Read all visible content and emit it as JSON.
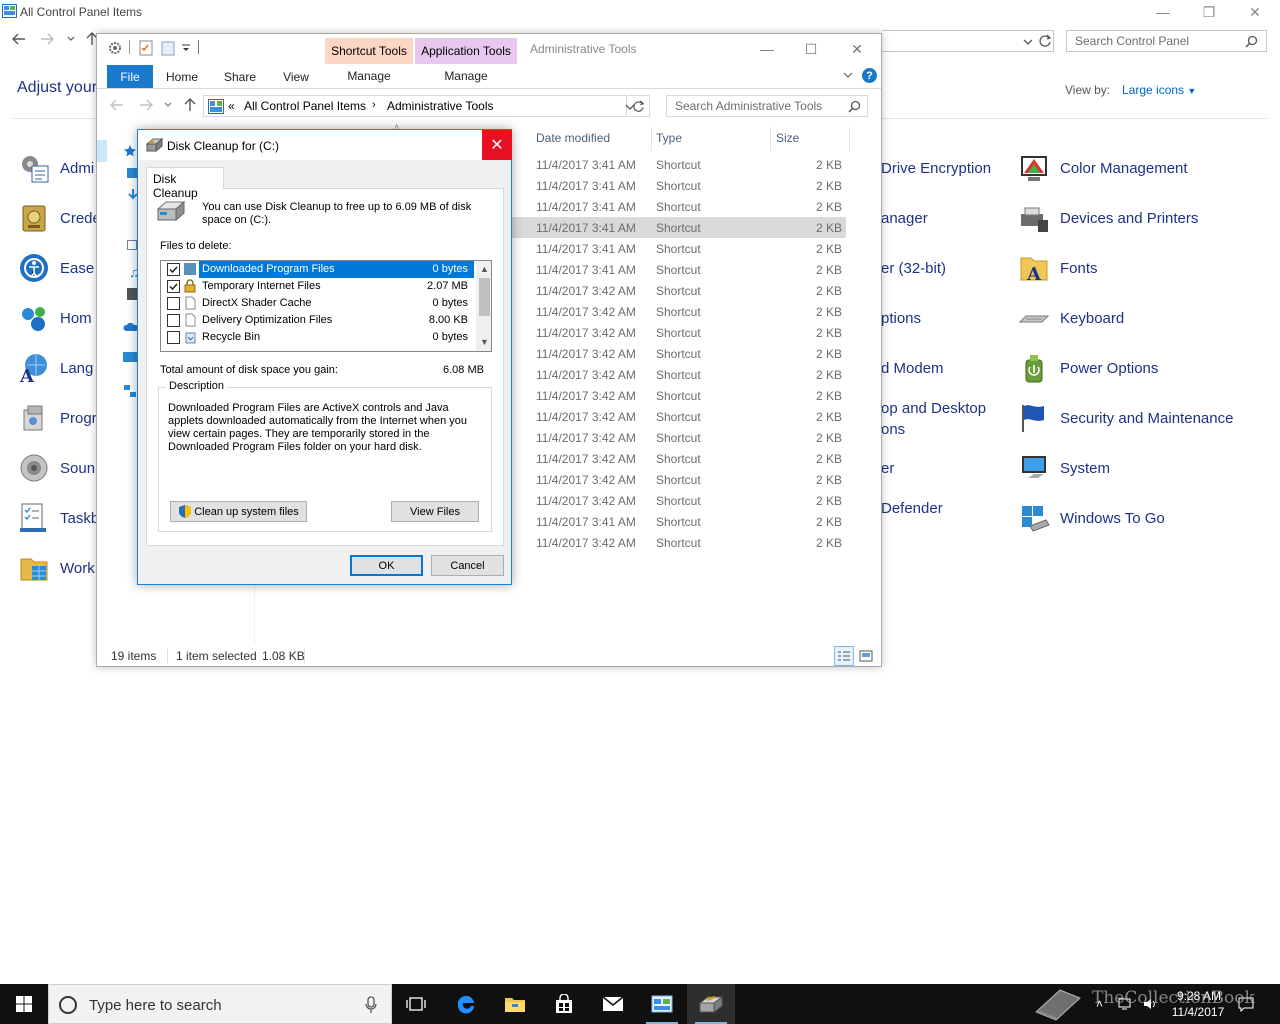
{
  "control_panel": {
    "window_title": "All Control Panel Items",
    "search_placeholder": "Search Control Panel",
    "heading": "Adjust your",
    "view_by_label": "View by:",
    "view_by_value": "Large icons",
    "left_items": [
      {
        "label": "Admi",
        "icon": "administrative-tools-icon"
      },
      {
        "label": "Crede",
        "icon": "credential-manager-icon"
      },
      {
        "label": "Ease",
        "icon": "ease-of-access-icon"
      },
      {
        "label": "Hom",
        "icon": "homegroup-icon"
      },
      {
        "label": "Lang",
        "icon": "language-icon"
      },
      {
        "label": "Progr",
        "icon": "programs-icon"
      },
      {
        "label": "Soun",
        "icon": "sound-icon"
      },
      {
        "label": "Taskb",
        "icon": "taskbar-icon"
      },
      {
        "label": "Work",
        "icon": "work-folders-icon"
      }
    ],
    "mid_items": [
      {
        "label": "Drive Encryption"
      },
      {
        "label": "anager"
      },
      {
        "label": "er (32-bit)"
      },
      {
        "label": "ptions"
      },
      {
        "label": "d Modem"
      },
      {
        "label": "op and Desktop"
      },
      {
        "label": "ons"
      },
      {
        "label": "er"
      },
      {
        "label": "Defender"
      }
    ],
    "right_items": [
      {
        "label": "Color Management",
        "icon": "color-management-icon"
      },
      {
        "label": "Devices and Printers",
        "icon": "devices-printers-icon"
      },
      {
        "label": "Fonts",
        "icon": "fonts-icon"
      },
      {
        "label": "Keyboard",
        "icon": "keyboard-icon"
      },
      {
        "label": "Power Options",
        "icon": "power-options-icon"
      },
      {
        "label": "Security and Maintenance",
        "icon": "security-flag-icon"
      },
      {
        "label": "System",
        "icon": "system-icon"
      },
      {
        "label": "Windows To Go",
        "icon": "windows-to-go-icon"
      }
    ]
  },
  "explorer": {
    "title": "Administrative Tools",
    "ctx_shortcut": "Shortcut Tools",
    "ctx_application": "Application Tools",
    "tabs": {
      "file": "File",
      "home": "Home",
      "share": "Share",
      "view": "View",
      "manage1": "Manage",
      "manage2": "Manage"
    },
    "breadcrumb": {
      "sep": "«",
      "parent": "All Control Panel Items",
      "current": "Administrative Tools"
    },
    "search_placeholder": "Search Administrative Tools",
    "columns": {
      "date": "Date modified",
      "type": "Type",
      "size": "Size"
    },
    "rows": [
      {
        "date": "11/4/2017 3:41 AM",
        "type": "Shortcut",
        "size": "2 KB"
      },
      {
        "date": "11/4/2017 3:41 AM",
        "type": "Shortcut",
        "size": "2 KB"
      },
      {
        "date": "11/4/2017 3:41 AM",
        "type": "Shortcut",
        "size": "2 KB"
      },
      {
        "date": "11/4/2017 3:41 AM",
        "type": "Shortcut",
        "size": "2 KB"
      },
      {
        "date": "11/4/2017 3:41 AM",
        "type": "Shortcut",
        "size": "2 KB"
      },
      {
        "date": "11/4/2017 3:41 AM",
        "type": "Shortcut",
        "size": "2 KB"
      },
      {
        "date": "11/4/2017 3:42 AM",
        "type": "Shortcut",
        "size": "2 KB"
      },
      {
        "date": "11/4/2017 3:42 AM",
        "type": "Shortcut",
        "size": "2 KB"
      },
      {
        "date": "11/4/2017 3:42 AM",
        "type": "Shortcut",
        "size": "2 KB"
      },
      {
        "date": "11/4/2017 3:42 AM",
        "type": "Shortcut",
        "size": "2 KB"
      },
      {
        "date": "11/4/2017 3:42 AM",
        "type": "Shortcut",
        "size": "2 KB"
      },
      {
        "date": "11/4/2017 3:42 AM",
        "type": "Shortcut",
        "size": "2 KB"
      },
      {
        "date": "11/4/2017 3:42 AM",
        "type": "Shortcut",
        "size": "2 KB"
      },
      {
        "date": "11/4/2017 3:42 AM",
        "type": "Shortcut",
        "size": "2 KB"
      },
      {
        "date": "11/4/2017 3:42 AM",
        "type": "Shortcut",
        "size": "2 KB"
      },
      {
        "date": "11/4/2017 3:42 AM",
        "type": "Shortcut",
        "size": "2 KB"
      },
      {
        "date": "11/4/2017 3:42 AM",
        "type": "Shortcut",
        "size": "2 KB"
      },
      {
        "date": "11/4/2017 3:41 AM",
        "type": "Shortcut",
        "size": "2 KB"
      },
      {
        "date": "11/4/2017 3:42 AM",
        "type": "Shortcut",
        "size": "2 KB"
      }
    ],
    "selected_row": 3,
    "status": {
      "count": "19 items",
      "selection": "1 item selected",
      "size": "1.08 KB"
    }
  },
  "disk_cleanup": {
    "title": "Disk Cleanup for  (C:)",
    "tab": "Disk Cleanup",
    "intro": "You can use Disk Cleanup to free up to 6.09 MB of disk space on  (C:).",
    "files_label": "Files to delete:",
    "items": [
      {
        "name": "Downloaded Program Files",
        "size": "0 bytes",
        "checked": true,
        "selected": true
      },
      {
        "name": "Temporary Internet Files",
        "size": "2.07 MB",
        "checked": true,
        "selected": false
      },
      {
        "name": "DirectX Shader Cache",
        "size": "0 bytes",
        "checked": false,
        "selected": false
      },
      {
        "name": "Delivery Optimization Files",
        "size": "8.00 KB",
        "checked": false,
        "selected": false
      },
      {
        "name": "Recycle Bin",
        "size": "0 bytes",
        "checked": false,
        "selected": false
      }
    ],
    "total_label": "Total amount of disk space you gain:",
    "total_value": "6.08 MB",
    "description_label": "Description",
    "description": "Downloaded Program Files are ActiveX controls and Java applets downloaded automatically from the Internet when you view certain pages. They are temporarily stored in the Downloaded Program Files folder on your hard disk.",
    "cleanup_system_label": "Clean up system files",
    "view_files_label": "View Files",
    "ok_label": "OK",
    "cancel_label": "Cancel"
  },
  "taskbar": {
    "search_placeholder": "Type here to search",
    "time": "9:28 AM",
    "date": "11/4/2017",
    "watermark": "TheCollectionBook"
  }
}
